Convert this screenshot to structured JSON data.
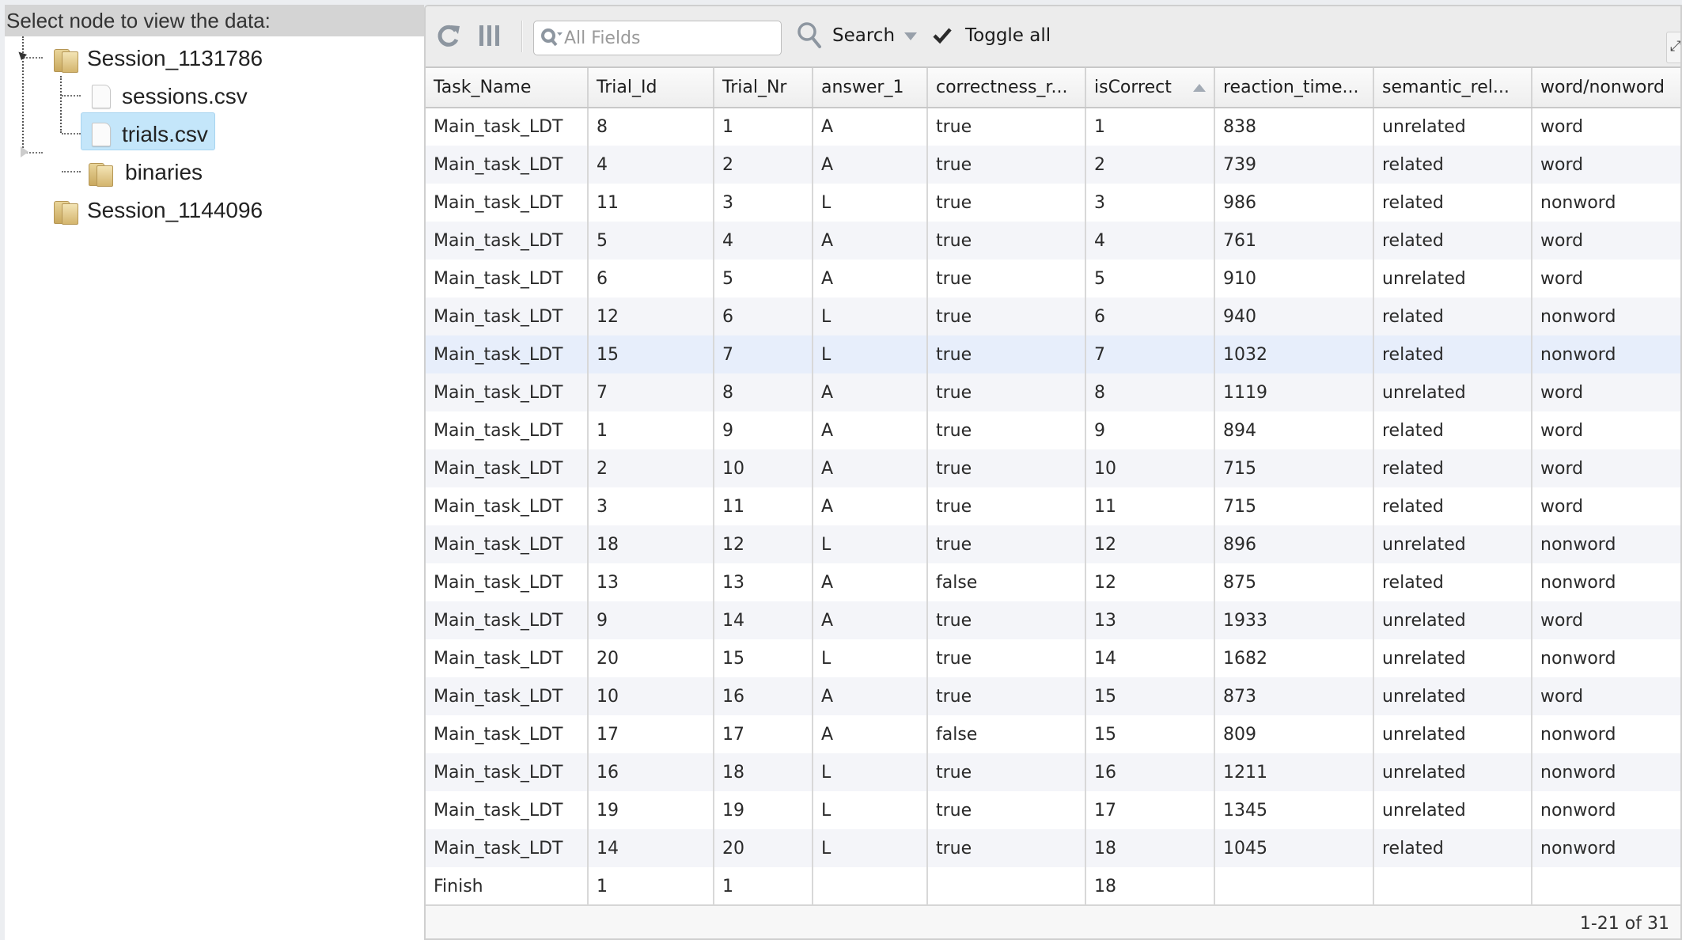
{
  "tree": {
    "header": "Select node to view the data:",
    "nodes": [
      {
        "label": "Session_1131786",
        "type": "folder",
        "expanded": true
      },
      {
        "label": "sessions.csv",
        "type": "file"
      },
      {
        "label": "trials.csv",
        "type": "file",
        "selected": true
      },
      {
        "label": "binaries",
        "type": "folder"
      },
      {
        "label": "Session_1144096",
        "type": "folder",
        "expanded": false
      }
    ]
  },
  "toolbar": {
    "refresh_icon": "refresh-icon",
    "columns_icon": "columns-icon",
    "search_placeholder": "All Fields",
    "search_value": "",
    "search_label": "Search",
    "toggle_all_label": "Toggle all",
    "corner_button_glyph": "⤢"
  },
  "grid": {
    "columns": [
      "Task_Name",
      "Trial_Id",
      "Trial_Nr",
      "answer_1",
      "correctness_r...",
      "isCorrect",
      "reaction_time...",
      "semantic_rel...",
      "word/nonword"
    ],
    "sorted_column": "isCorrect",
    "sort_direction": "ascending",
    "hovered_row": 6,
    "rows": [
      [
        "Main_task_LDT",
        "8",
        "1",
        "A",
        "true",
        "1",
        "838",
        "unrelated",
        "word"
      ],
      [
        "Main_task_LDT",
        "4",
        "2",
        "A",
        "true",
        "2",
        "739",
        "related",
        "word"
      ],
      [
        "Main_task_LDT",
        "11",
        "3",
        "L",
        "true",
        "3",
        "986",
        "related",
        "nonword"
      ],
      [
        "Main_task_LDT",
        "5",
        "4",
        "A",
        "true",
        "4",
        "761",
        "related",
        "word"
      ],
      [
        "Main_task_LDT",
        "6",
        "5",
        "A",
        "true",
        "5",
        "910",
        "unrelated",
        "word"
      ],
      [
        "Main_task_LDT",
        "12",
        "6",
        "L",
        "true",
        "6",
        "940",
        "related",
        "nonword"
      ],
      [
        "Main_task_LDT",
        "15",
        "7",
        "L",
        "true",
        "7",
        "1032",
        "related",
        "nonword"
      ],
      [
        "Main_task_LDT",
        "7",
        "8",
        "A",
        "true",
        "8",
        "1119",
        "unrelated",
        "word"
      ],
      [
        "Main_task_LDT",
        "1",
        "9",
        "A",
        "true",
        "9",
        "894",
        "related",
        "word"
      ],
      [
        "Main_task_LDT",
        "2",
        "10",
        "A",
        "true",
        "10",
        "715",
        "related",
        "word"
      ],
      [
        "Main_task_LDT",
        "3",
        "11",
        "A",
        "true",
        "11",
        "715",
        "related",
        "word"
      ],
      [
        "Main_task_LDT",
        "18",
        "12",
        "L",
        "true",
        "12",
        "896",
        "unrelated",
        "nonword"
      ],
      [
        "Main_task_LDT",
        "13",
        "13",
        "A",
        "false",
        "12",
        "875",
        "related",
        "nonword"
      ],
      [
        "Main_task_LDT",
        "9",
        "14",
        "A",
        "true",
        "13",
        "1933",
        "unrelated",
        "word"
      ],
      [
        "Main_task_LDT",
        "20",
        "15",
        "L",
        "true",
        "14",
        "1682",
        "unrelated",
        "nonword"
      ],
      [
        "Main_task_LDT",
        "10",
        "16",
        "A",
        "true",
        "15",
        "873",
        "unrelated",
        "word"
      ],
      [
        "Main_task_LDT",
        "17",
        "17",
        "A",
        "false",
        "15",
        "809",
        "unrelated",
        "nonword"
      ],
      [
        "Main_task_LDT",
        "16",
        "18",
        "L",
        "true",
        "16",
        "1211",
        "unrelated",
        "nonword"
      ],
      [
        "Main_task_LDT",
        "19",
        "19",
        "L",
        "true",
        "17",
        "1345",
        "unrelated",
        "nonword"
      ],
      [
        "Main_task_LDT",
        "14",
        "20",
        "L",
        "true",
        "18",
        "1045",
        "related",
        "nonword"
      ],
      [
        "Finish",
        "1",
        "1",
        "",
        "",
        "18",
        "",
        "",
        ""
      ]
    ],
    "pager": "1-21 of 31"
  }
}
